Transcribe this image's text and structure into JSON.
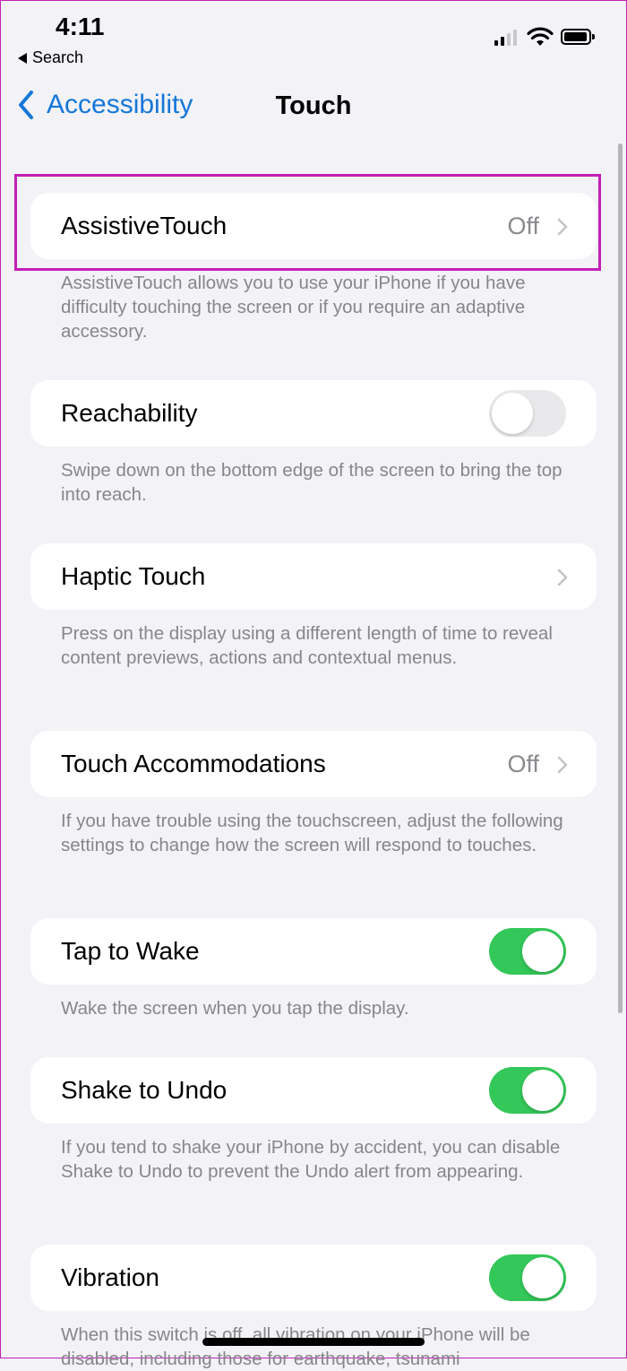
{
  "status_bar": {
    "time": "4:11",
    "back_app": "Search"
  },
  "nav": {
    "back_label": "Accessibility",
    "title": "Touch"
  },
  "rows": [
    {
      "label": "AssistiveTouch",
      "value": "Off",
      "control": "chevron",
      "footer": "AssistiveTouch allows you to use your iPhone if you have difficulty touching the screen or if you require an adaptive accessory."
    },
    {
      "label": "Reachability",
      "control": "toggle",
      "toggle_on": false,
      "footer": "Swipe down on the bottom edge of the screen to bring the top into reach."
    },
    {
      "label": "Haptic Touch",
      "control": "chevron",
      "footer": "Press on the display using a different length of time to reveal content previews, actions and contextual menus."
    },
    {
      "label": "Touch Accommodations",
      "value": "Off",
      "control": "chevron",
      "footer": "If you have trouble using the touchscreen, adjust the following settings to change how the screen will respond to touches."
    },
    {
      "label": "Tap to Wake",
      "control": "toggle",
      "toggle_on": true,
      "footer": "Wake the screen when you tap the display."
    },
    {
      "label": "Shake to Undo",
      "control": "toggle",
      "toggle_on": true,
      "footer": "If you tend to shake your iPhone by accident, you can disable Shake to Undo to prevent the Undo alert from appearing."
    },
    {
      "label": "Vibration",
      "control": "toggle",
      "toggle_on": true,
      "footer": "When this switch is off, all vibration on your iPhone will be disabled, including those for earthquake, tsunami"
    }
  ],
  "colors": {
    "accent": "#1577d8",
    "toggle_on": "#34c759",
    "highlight": "#c41fb8"
  }
}
